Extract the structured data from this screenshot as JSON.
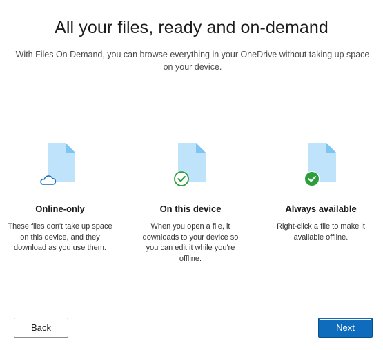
{
  "title": "All your files, ready and on-demand",
  "subtitle": "With Files On Demand, you can browse everything in your OneDrive without taking up space on your device.",
  "columns": [
    {
      "icon": "cloud-icon",
      "title": "Online-only",
      "description": "These files don't take up space on this device, and they download as you use them."
    },
    {
      "icon": "check-outline-icon",
      "title": "On this device",
      "description": "When you open a file, it downloads to your device so you can edit it while you're offline."
    },
    {
      "icon": "check-filled-icon",
      "title": "Always available",
      "description": "Right-click a file to make it available offline."
    }
  ],
  "buttons": {
    "back_label": "Back",
    "next_label": "Next"
  },
  "colors": {
    "file_fill": "#bfe3fb",
    "file_fold": "#7ec5f2",
    "cloud_stroke": "#0f6cbd",
    "check_green": "#2c9e3b",
    "primary": "#0f6cbd"
  }
}
